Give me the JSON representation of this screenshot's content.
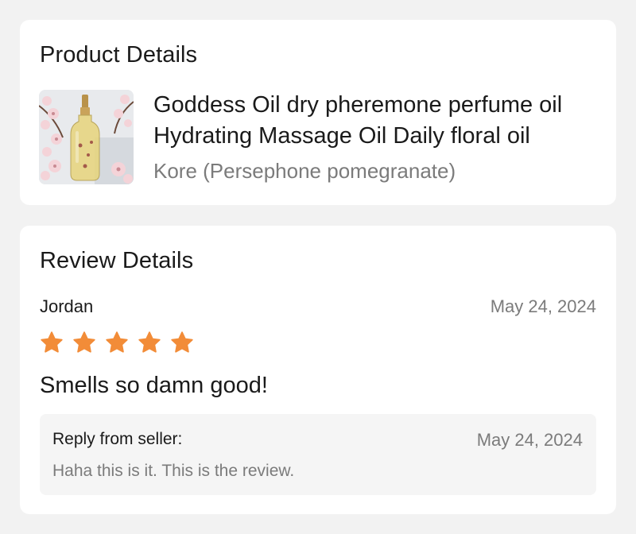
{
  "product_card": {
    "title": "Product Details",
    "product_name": "Goddess Oil dry pheremone perfume oil Hydrating Massage Oil Daily floral oil",
    "variant": "Kore (Persephone pomegranate)",
    "thumbnail_icon": "perfume-oil-bottle-image"
  },
  "review_card": {
    "title": "Review Details",
    "reviewer": "Jordan",
    "date": "May 24, 2024",
    "rating": 5,
    "rating_max": 5,
    "review_text": "Smells so damn good!",
    "reply": {
      "label": "Reply from seller:",
      "date": "May 24, 2024",
      "text": "Haha this is it. This is the review."
    }
  },
  "colors": {
    "star": "#f28c38",
    "background": "#f2f2f2",
    "card": "#ffffff",
    "muted_text": "#7b7b7b",
    "reply_bg": "#f5f5f5"
  }
}
